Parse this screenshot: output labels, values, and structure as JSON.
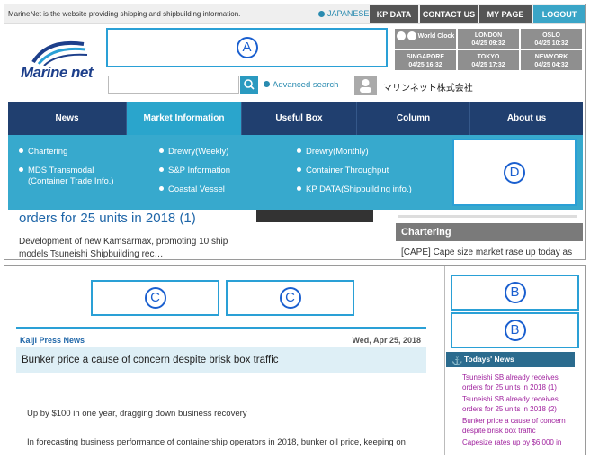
{
  "topbar": {
    "description": "MarineNet is the website providing shipping and shipbuilding information.",
    "language": "JAPANESE",
    "buttons": [
      "KP DATA",
      "CONTACT US",
      "MY PAGE",
      "LOGOUT"
    ]
  },
  "logo": {
    "text": "Marine net"
  },
  "annotations": {
    "a": "A",
    "b": "B",
    "c": "C",
    "d": "D"
  },
  "world_clock": {
    "label": "World Clock",
    "cities": [
      {
        "name": "LONDON",
        "time": "04/25 09:32"
      },
      {
        "name": "OSLO",
        "time": "04/25 10:32"
      },
      {
        "name": "SINGAPORE",
        "time": "04/25 16:32"
      },
      {
        "name": "TOKYO",
        "time": "04/25 17:32"
      },
      {
        "name": "NEWYORK",
        "time": "04/25 04:32"
      }
    ]
  },
  "search": {
    "placeholder": "",
    "advanced": "Advanced search"
  },
  "user": {
    "name": "マリンネット株式会社"
  },
  "nav": {
    "items": [
      "News",
      "Market Information",
      "Useful Box",
      "Column",
      "About us"
    ]
  },
  "dropdown": {
    "col1": [
      "Chartering",
      "MDS Transmodal",
      "(Container Trade Info.)"
    ],
    "col2": [
      "Drewry(Weekly)",
      "S&P Information",
      "Coastal Vessel"
    ],
    "col3": [
      "Drewry(Monthly)",
      "Container Throughput",
      "KP DATA(Shipbuilding info.)"
    ]
  },
  "main": {
    "headline": "orders for 25 units in 2018 (1)",
    "para1": "Development of new Kamsarmax, promoting 10 ship",
    "para2": "models Tsuneishi Shipbuilding rec…"
  },
  "chartering": {
    "title": "Chartering",
    "line": "[CAPE] Cape size market rase up today as"
  },
  "article": {
    "source": "Kaiji Press News",
    "date": "Wed, Apr 25, 2018",
    "title": "Bunker price a cause of concern despite brisk box traffic",
    "body1": "Up by $100 in one year, dragging down business recovery",
    "body2": "In forecasting business performance of containership operators in 2018, bunker oil price, keeping on"
  },
  "todays_news": {
    "title": "Todays' News",
    "items": [
      "Tsuneishi SB already receives",
      "orders for 25 units in 2018 (1)",
      "Tsuneishi SB already receives",
      "orders for 25 units in 2018 (2)",
      "Bunker price a cause of concern",
      "despite brisk box traffic",
      "Capesize rates up by $6,000 in"
    ]
  }
}
